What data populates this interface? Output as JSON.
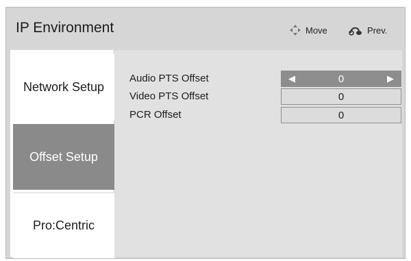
{
  "header": {
    "title": "IP Environment",
    "hints": [
      {
        "icon": "move-arrows-icon",
        "label": "Move"
      },
      {
        "icon": "return-icon",
        "label": "Prev."
      }
    ]
  },
  "sidebar": {
    "items": [
      {
        "label": "Network Setup",
        "selected": false
      },
      {
        "label": "Offset Setup",
        "selected": true
      },
      {
        "label": "Pro:Centric",
        "selected": false
      }
    ]
  },
  "settings": {
    "rows": [
      {
        "label": "Audio PTS Offset",
        "value": "0",
        "focused": true
      },
      {
        "label": "Video PTS Offset",
        "value": "0",
        "focused": false
      },
      {
        "label": "PCR Offset",
        "value": "0",
        "focused": false
      }
    ],
    "arrow_left": "◀",
    "arrow_right": "▶"
  }
}
